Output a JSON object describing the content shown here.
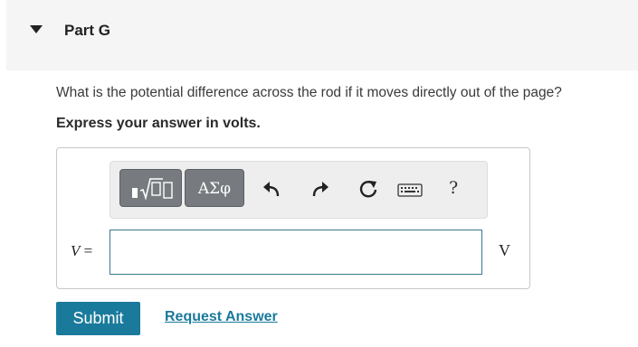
{
  "part": {
    "title": "Part G"
  },
  "question": {
    "text": "What is the potential difference across the rod if it moves directly out of the page?",
    "instruction": "Express your answer in volts."
  },
  "toolbar": {
    "templates_icon": "templates-sqrt-icon",
    "symbols_label": "ΑΣφ",
    "undo_icon": "undo-icon",
    "redo_icon": "redo-icon",
    "reset_icon": "reset-icon",
    "keyboard_icon": "keyboard-icon",
    "help_label": "?"
  },
  "answer": {
    "variable": "V",
    "equals": "=",
    "value": "",
    "unit": "V"
  },
  "actions": {
    "submit_label": "Submit",
    "request_label": "Request Answer"
  },
  "colors": {
    "accent": "#1a7a9c",
    "header_bg": "#f5f5f5",
    "toolbar_button": "#777b7f"
  }
}
